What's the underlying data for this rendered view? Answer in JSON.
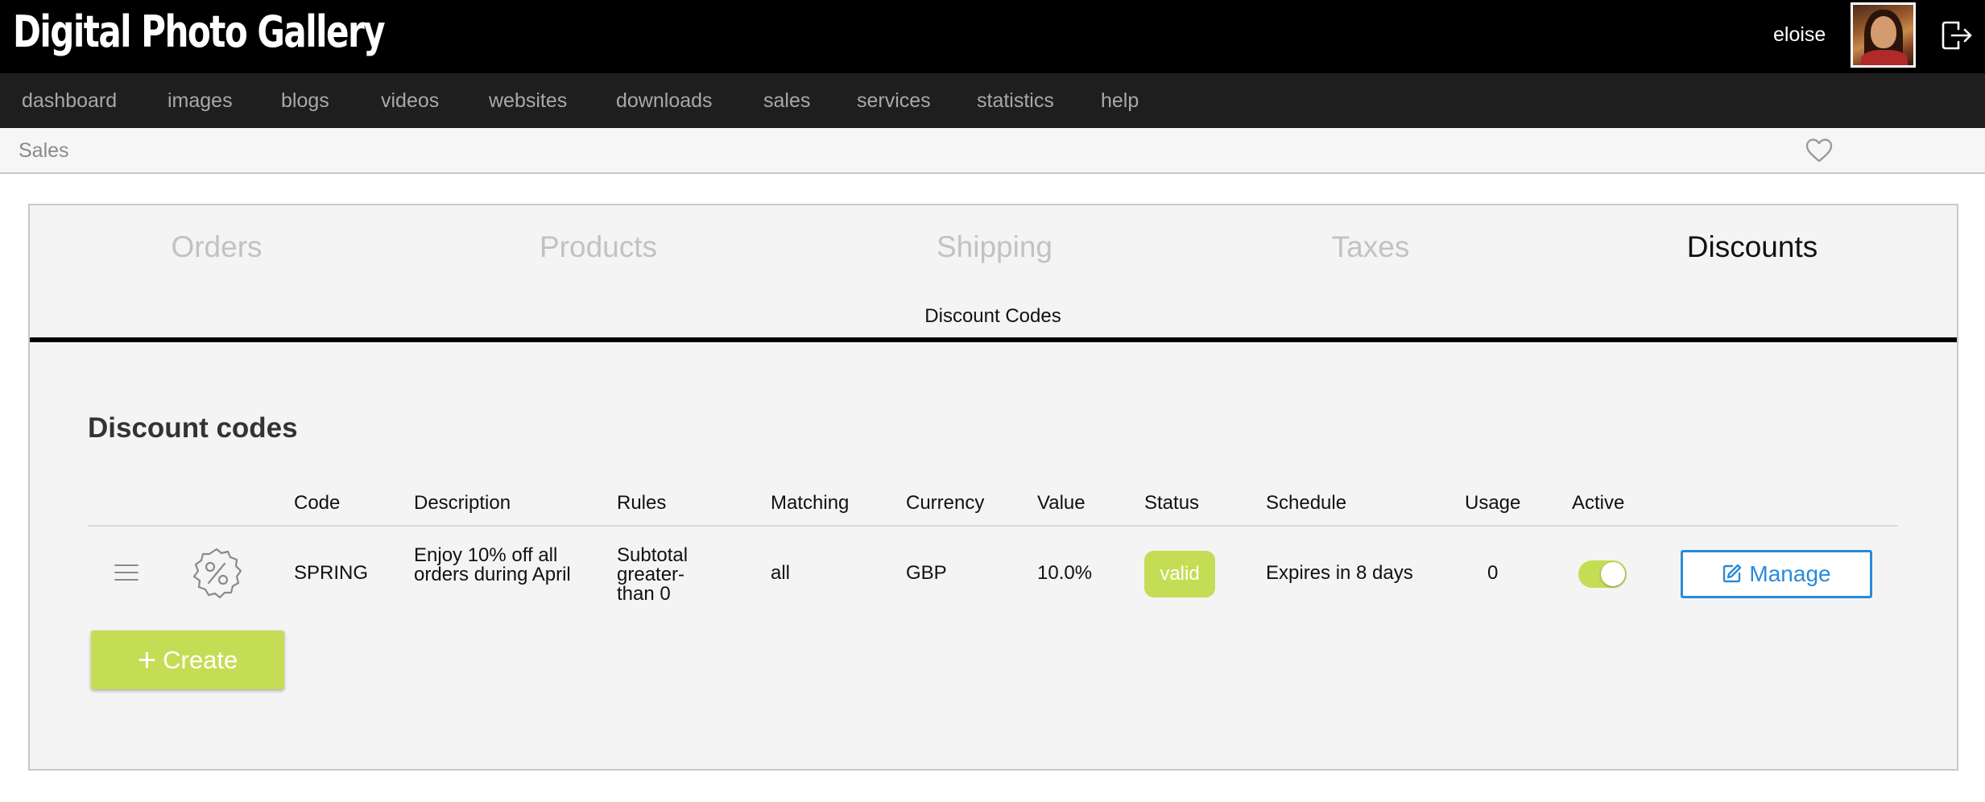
{
  "app": {
    "title": "Digital Photo Gallery",
    "username": "eloise"
  },
  "nav": {
    "items": [
      "dashboard",
      "images",
      "blogs",
      "videos",
      "websites",
      "downloads",
      "sales",
      "services",
      "statistics",
      "help"
    ]
  },
  "breadcrumb": {
    "current": "Sales"
  },
  "tabs": {
    "items": [
      "Orders",
      "Products",
      "Shipping",
      "Taxes",
      "Discounts"
    ],
    "active": "Discounts",
    "subtab": "Discount Codes"
  },
  "section": {
    "title": "Discount codes"
  },
  "table": {
    "headers": [
      "Code",
      "Description",
      "Rules",
      "Matching",
      "Currency",
      "Value",
      "Status",
      "Schedule",
      "Usage",
      "Active"
    ],
    "rows": [
      {
        "code": "SPRING",
        "description": "Enjoy 10% off all orders during April",
        "rules": "Subtotal greater-than 0",
        "matching": "all",
        "currency": "GBP",
        "value": "10.0%",
        "status": "valid",
        "schedule": "Expires in 8 days",
        "usage": "0",
        "active": true,
        "manage_label": "Manage"
      }
    ]
  },
  "actions": {
    "create_label": "Create"
  },
  "icons": {
    "logout": "logout-icon",
    "favorite": "heart-icon",
    "drag": "drag-handle-icon",
    "discount": "percent-badge-icon",
    "edit": "edit-icon",
    "add": "plus-icon"
  },
  "colors": {
    "accent_green": "#c5dd55",
    "link_blue": "#2a8ad8",
    "topbar": "#000000",
    "navbar": "#1e1e1e"
  }
}
